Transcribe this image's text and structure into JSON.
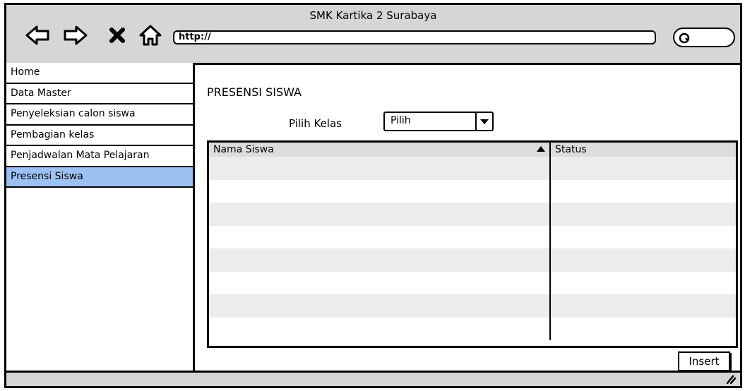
{
  "window": {
    "title": "SMK Kartika 2 Surabaya"
  },
  "toolbar": {
    "back_icon": "back-arrow-icon",
    "forward_icon": "forward-arrow-icon",
    "stop_icon": "close-icon",
    "home_icon": "home-icon",
    "url": "http://",
    "search_icon": "search-icon"
  },
  "sidebar": {
    "items": [
      {
        "label": "Home"
      },
      {
        "label": "Data Master"
      },
      {
        "label": "Penyeleksian calon siswa"
      },
      {
        "label": "Pembagian kelas"
      },
      {
        "label": "Penjadwalan Mata Pelajaran"
      },
      {
        "label": "Presensi Siswa"
      }
    ],
    "active_color": "#9cc2f3"
  },
  "main": {
    "title": "PRESENSI SISWA",
    "kelas_label": "Pilih Kelas",
    "kelas_select": "Pilih",
    "table": {
      "columns": [
        "Nama Siswa",
        "Status"
      ],
      "rows": [
        [
          "",
          ""
        ],
        [
          "",
          ""
        ],
        [
          "",
          ""
        ],
        [
          "",
          ""
        ],
        [
          "",
          ""
        ],
        [
          "",
          ""
        ],
        [
          "",
          ""
        ],
        [
          "",
          ""
        ]
      ]
    },
    "insert_label": "Insert"
  }
}
